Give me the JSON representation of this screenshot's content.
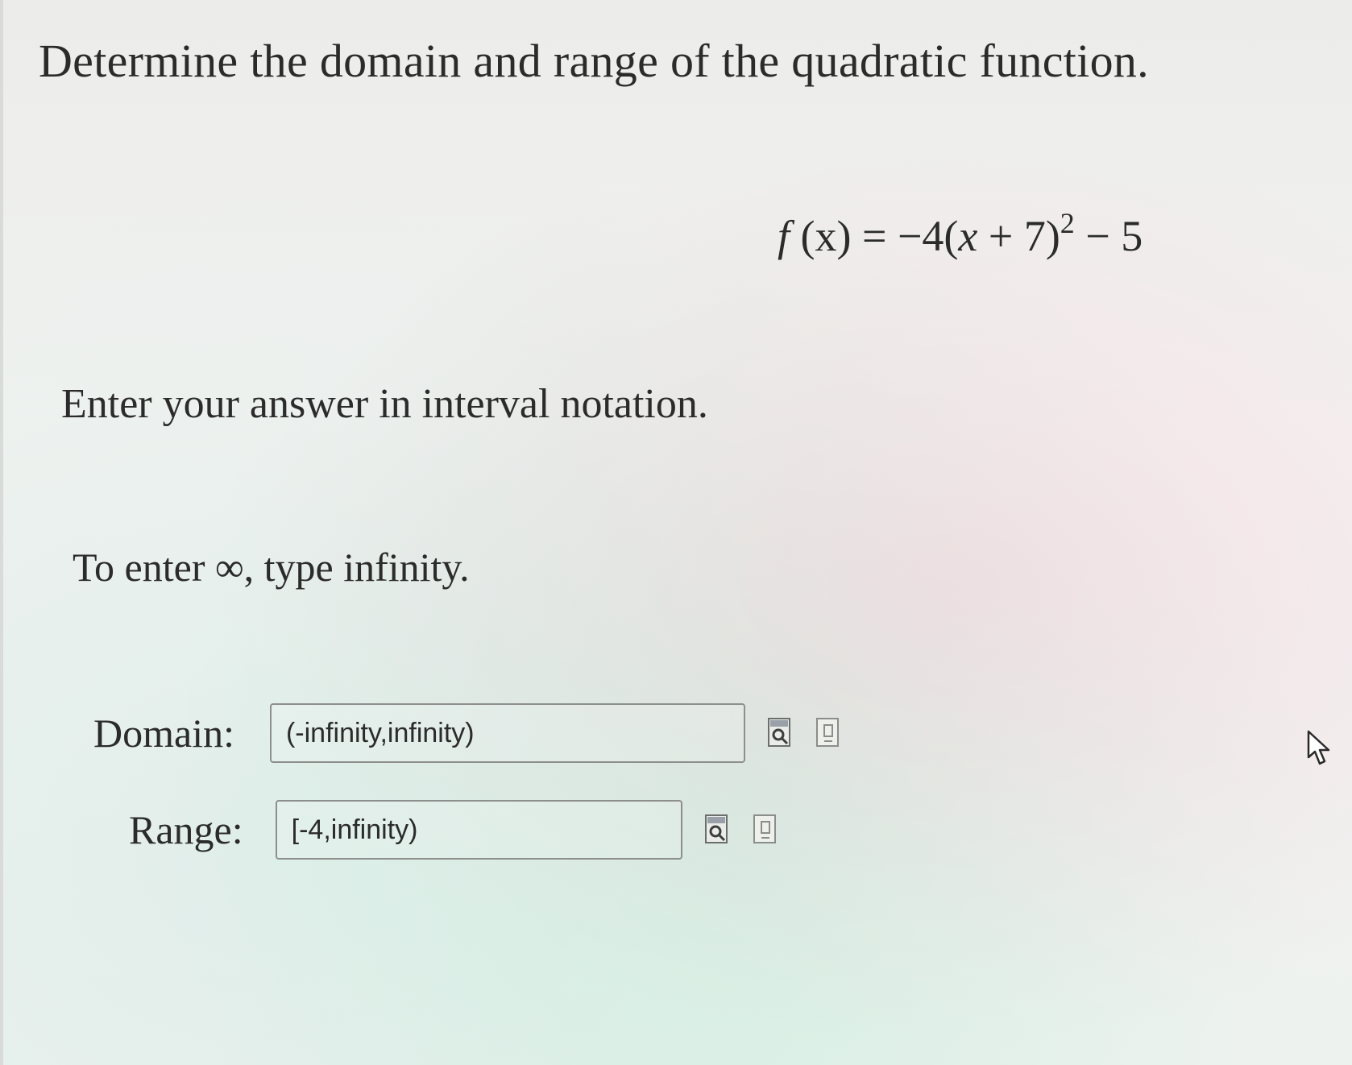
{
  "question": {
    "title": "Determine the domain and range of the quadratic function."
  },
  "formula": {
    "lhs_fn": "f",
    "lhs_var": "(x)",
    "equals": "=",
    "coef": "−4(",
    "var": "x",
    "inner": " + 7)",
    "exponent": "2",
    "tail": " − 5"
  },
  "instruction": "Enter your answer in interval notation.",
  "tip": "To enter ∞, type infinity.",
  "domain": {
    "label": "Domain:",
    "value": "(-infinity,infinity)",
    "icons": [
      "preview-icon",
      "help-icon"
    ]
  },
  "range": {
    "label": "Range:",
    "value": "[-4,infinity)",
    "icons": [
      "preview-icon",
      "help-icon"
    ]
  },
  "cursor": "mouse-pointer-icon"
}
